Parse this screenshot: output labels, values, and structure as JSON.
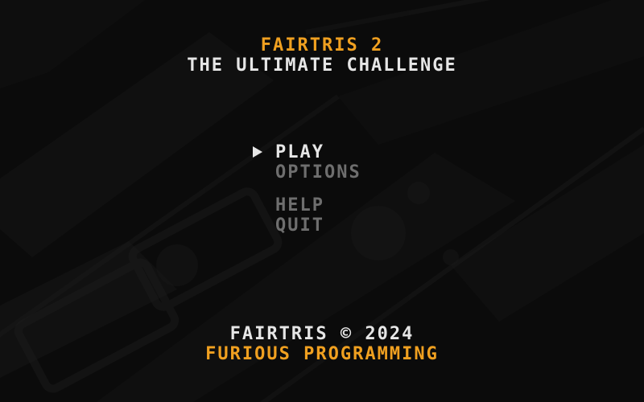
{
  "header": {
    "title": "FAIRTRIS 2",
    "subtitle": "THE ULTIMATE CHALLENGE"
  },
  "menu": {
    "selected_index": 0,
    "items": [
      {
        "label": "PLAY"
      },
      {
        "label": "OPTIONS"
      },
      {
        "label": "HELP"
      },
      {
        "label": "QUIT"
      }
    ]
  },
  "footer": {
    "copyright": "FAIRTRIS © 2024",
    "author": "FURIOUS PROGRAMMING"
  },
  "colors": {
    "accent_orange": "#f0a020",
    "text_white": "#e6e6e6",
    "menu_selected": "#e6e6e6",
    "menu_inactive": "#6e6e6e",
    "background": "#0b0b0b"
  },
  "icons": {
    "menu_cursor": "triangle-right-icon"
  }
}
